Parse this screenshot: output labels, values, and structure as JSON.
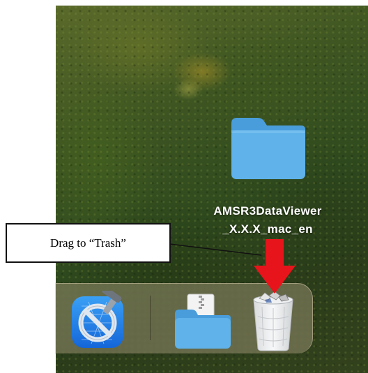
{
  "callout": {
    "text": "Drag to “Trash”"
  },
  "desktop": {
    "folder": {
      "name_line1": "AMSR3DataViewer",
      "name_line2": "_X.X.X_mac_en",
      "icon": "folder-icon"
    }
  },
  "arrow": {
    "icon": "red-down-arrow",
    "color": "#e8141b"
  },
  "dock": {
    "items": [
      {
        "name": "Xcode",
        "icon": "xcode-icon"
      },
      {
        "name": "AMSR3DataViewer folder",
        "icon": "folder-zip-icon"
      },
      {
        "name": "Trash",
        "icon": "trash-icon"
      }
    ]
  },
  "colors": {
    "folder_blue": "#5fb2ea",
    "folder_tab": "#4a9ddb",
    "arrow_red": "#e8141b",
    "callout_border": "#111111"
  }
}
